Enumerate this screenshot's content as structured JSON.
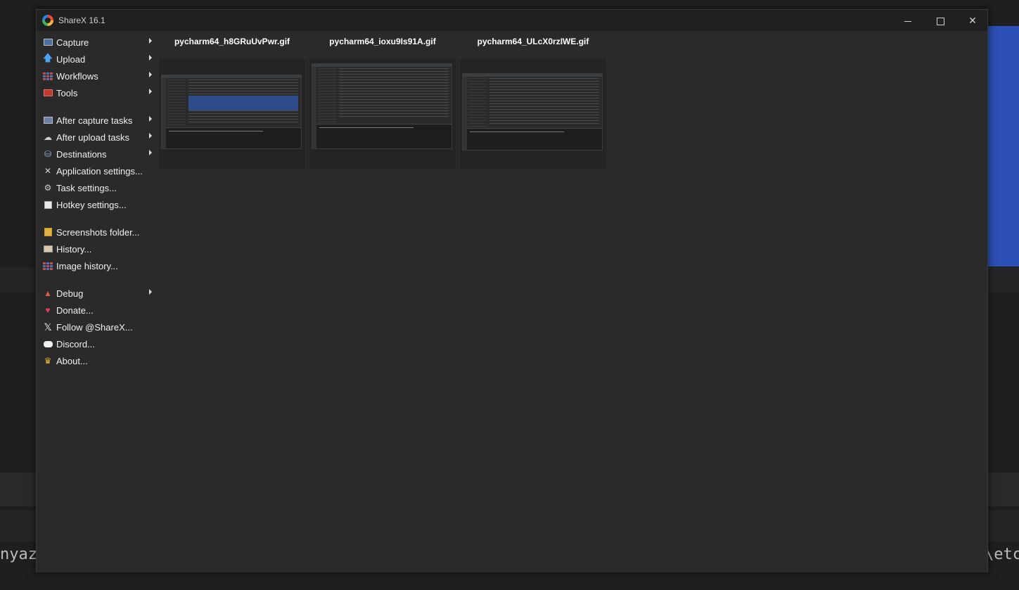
{
  "window": {
    "title": "ShareX 16.1"
  },
  "menu": {
    "groups": [
      [
        {
          "label": "Capture",
          "icon": "capture-icon",
          "submenu": true
        },
        {
          "label": "Upload",
          "icon": "upload-arrow-icon",
          "submenu": true
        },
        {
          "label": "Workflows",
          "icon": "workflows-grid-icon",
          "submenu": true
        },
        {
          "label": "Tools",
          "icon": "toolbox-icon",
          "submenu": true
        }
      ],
      [
        {
          "label": "After capture tasks",
          "icon": "after-capture-icon",
          "submenu": true
        },
        {
          "label": "After upload tasks",
          "icon": "cloud-icon",
          "submenu": true
        },
        {
          "label": "Destinations",
          "icon": "destinations-icon",
          "submenu": true
        },
        {
          "label": "Application settings...",
          "icon": "wrench-icon",
          "submenu": false
        },
        {
          "label": "Task settings...",
          "icon": "gear-icon",
          "submenu": false
        },
        {
          "label": "Hotkey settings...",
          "icon": "keyboard-icon",
          "submenu": false
        }
      ],
      [
        {
          "label": "Screenshots folder...",
          "icon": "folder-icon",
          "submenu": false
        },
        {
          "label": "History...",
          "icon": "history-icon",
          "submenu": false
        },
        {
          "label": "Image history...",
          "icon": "image-history-icon",
          "submenu": false
        }
      ],
      [
        {
          "label": "Debug",
          "icon": "debug-icon",
          "submenu": true
        },
        {
          "label": "Donate...",
          "icon": "heart-icon",
          "submenu": false
        },
        {
          "label": "Follow @ShareX...",
          "icon": "x-logo-icon",
          "submenu": false
        },
        {
          "label": "Discord...",
          "icon": "discord-icon",
          "submenu": false
        },
        {
          "label": "About...",
          "icon": "crown-icon",
          "submenu": false
        }
      ]
    ]
  },
  "thumbnails": [
    {
      "filename": "pycharm64_h8GRuUvPwr.gif"
    },
    {
      "filename": "pycharm64_ioxu9Is91A.gif"
    },
    {
      "filename": "pycharm64_ULcX0rzIWE.gif"
    }
  ],
  "background": {
    "left_text": "nyaz",
    "right_text": "\\etc"
  },
  "colors": {
    "window_bg": "#2a2a2a",
    "titlebar_bg": "#202020",
    "accent_blue": "#2d4fb8"
  }
}
